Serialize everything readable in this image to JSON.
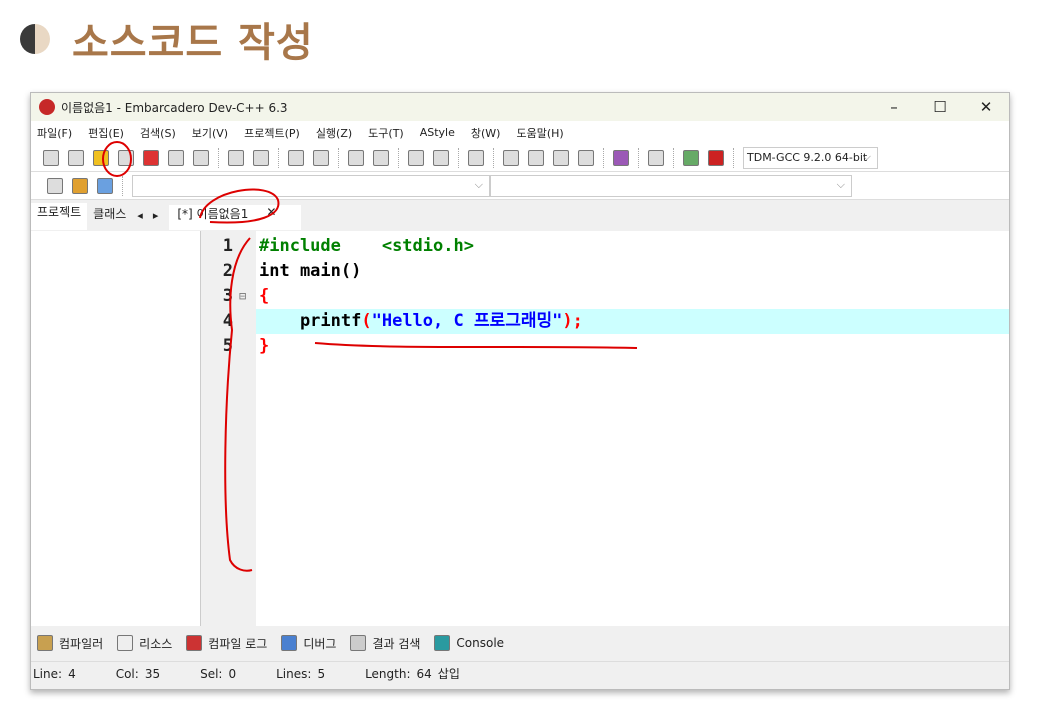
{
  "heading": "소스코드 작성",
  "window": {
    "title": "이름없음1 - Embarcadero Dev-C++ 6.3",
    "logo": "DEV"
  },
  "menu": [
    "파일(F)",
    "편집(E)",
    "검색(S)",
    "보기(V)",
    "프로젝트(P)",
    "실행(Z)",
    "도구(T)",
    "AStyle",
    "창(W)",
    "도움말(H)"
  ],
  "compiler": "TDM-GCC 9.2.0 64-bit",
  "panel_tabs": [
    "프로젝트",
    "클래스"
  ],
  "file_tab": "[*] 이름없음1",
  "code": [
    {
      "n": "1",
      "parts": [
        [
          "#include",
          "#008000"
        ],
        [
          "    <stdio.h>",
          "#008000"
        ]
      ]
    },
    {
      "n": "2",
      "parts": [
        [
          "int main()",
          "#000"
        ]
      ]
    },
    {
      "n": "3",
      "parts": [
        [
          "{",
          "#ff0000"
        ]
      ]
    },
    {
      "n": "4",
      "parts": [
        [
          "    printf",
          "#000"
        ],
        [
          "(",
          "#ff0000"
        ],
        [
          "\"Hello, C 프로그래밍\"",
          "#0000ff"
        ],
        [
          ");",
          "#ff0000"
        ]
      ]
    },
    {
      "n": "5",
      "parts": [
        [
          "}",
          "#ff0000"
        ]
      ]
    }
  ],
  "current_line_color": "#ccffff",
  "bottom_tabs": [
    "컴파일러",
    "리소스",
    "컴파일 로그",
    "디버그",
    "결과 검색",
    "Console"
  ],
  "status": {
    "line_label": "Line:",
    "line": "4",
    "col_label": "Col:",
    "col": "35",
    "sel_label": "Sel:",
    "sel": "0",
    "lines_label": "Lines:",
    "lines": "5",
    "length_label": "Length:",
    "length": "64",
    "mode": "삽입"
  }
}
